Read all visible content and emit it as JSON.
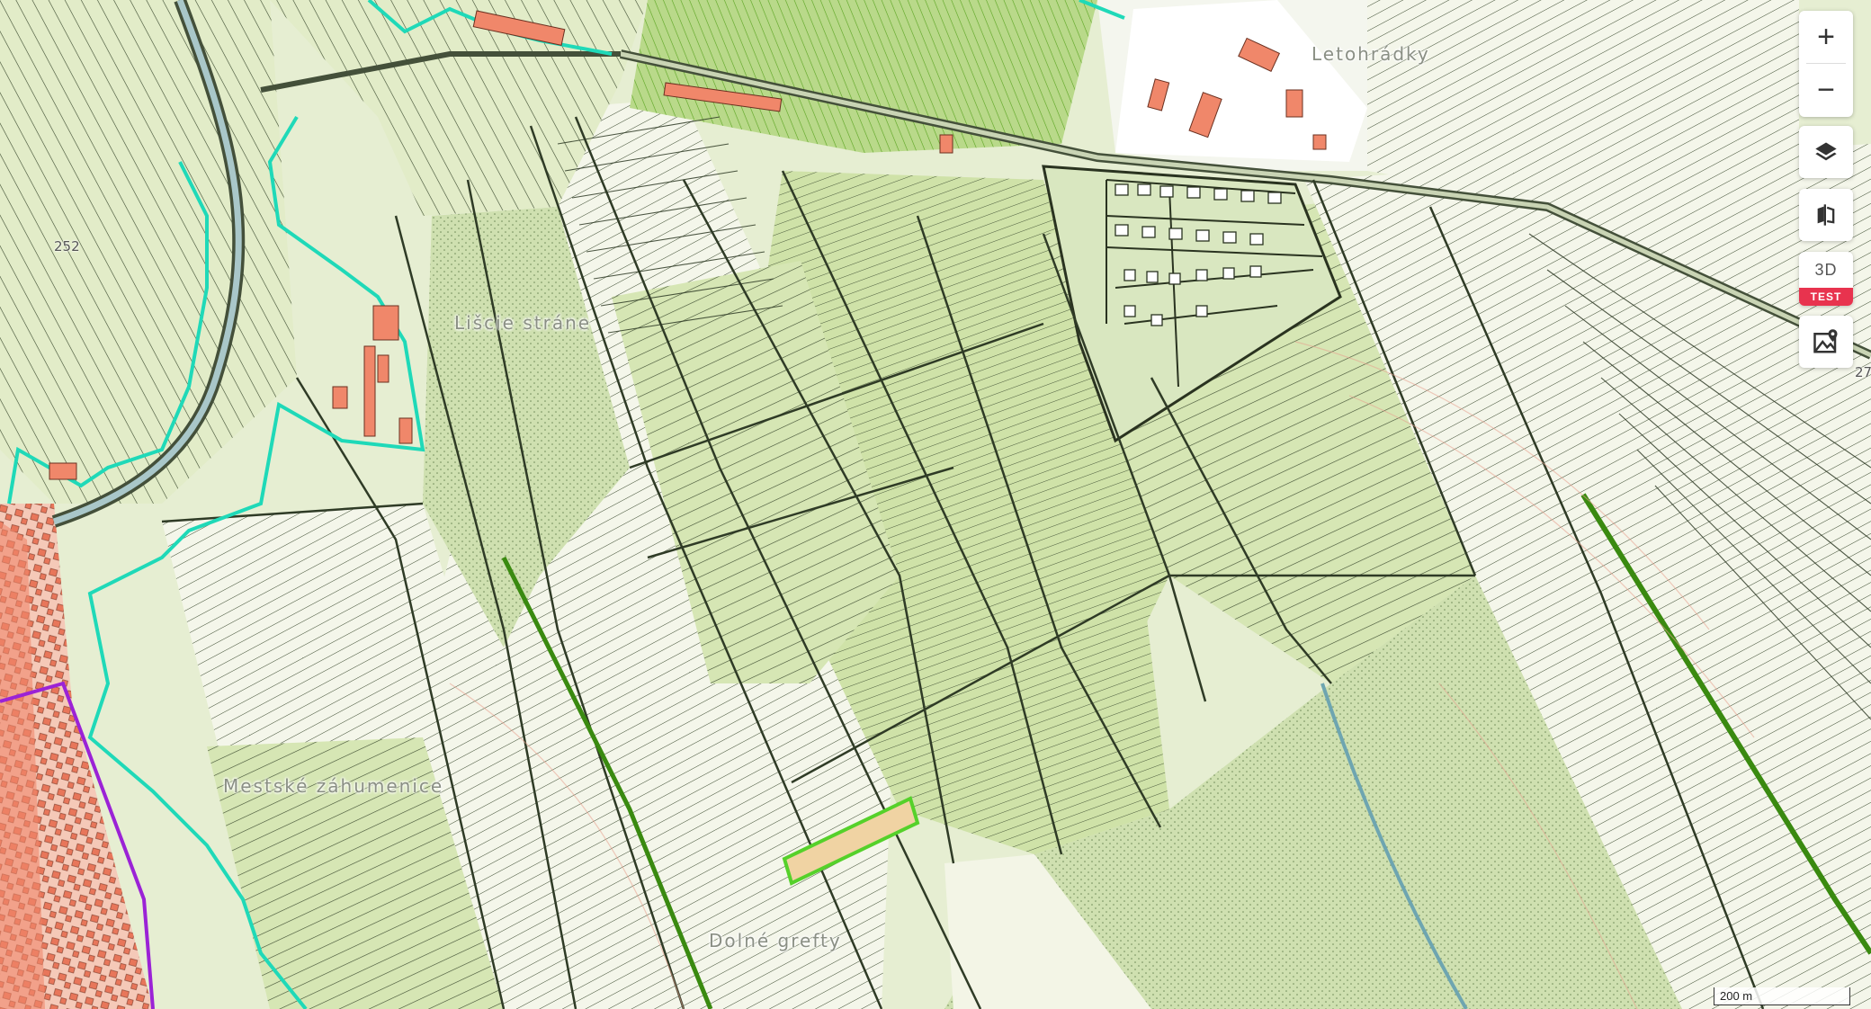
{
  "map": {
    "place_labels": [
      {
        "text": "Letohrádky"
      },
      {
        "text": "Lišcie stráne"
      },
      {
        "text": "Mestské záhumenice"
      },
      {
        "text": "Dolné grefty"
      }
    ],
    "parcel_numbers": [
      "252"
    ],
    "edge_label": "27",
    "scale_label": "200 m"
  },
  "controls": {
    "zoom_in": "+",
    "zoom_out": "−",
    "mode_3d": "3D",
    "mode_3d_badge": "TEST"
  },
  "icons": [
    "plus-icon",
    "minus-icon",
    "layers-icon",
    "compare-icon",
    "map-pin-icon"
  ],
  "colors": {
    "background": "#eef2dc",
    "vineyard": "#cfe2a8",
    "meadow": "#dde9bf",
    "building": "#f0876a",
    "district_boundary": "#1fd9b8",
    "municipal_boundary": "#9b22d6",
    "selected_parcel": "#55d12a",
    "selected_fill": "#f0d3a3",
    "parcel_line": "#3a4a30",
    "test_badge": "#e8334e"
  }
}
